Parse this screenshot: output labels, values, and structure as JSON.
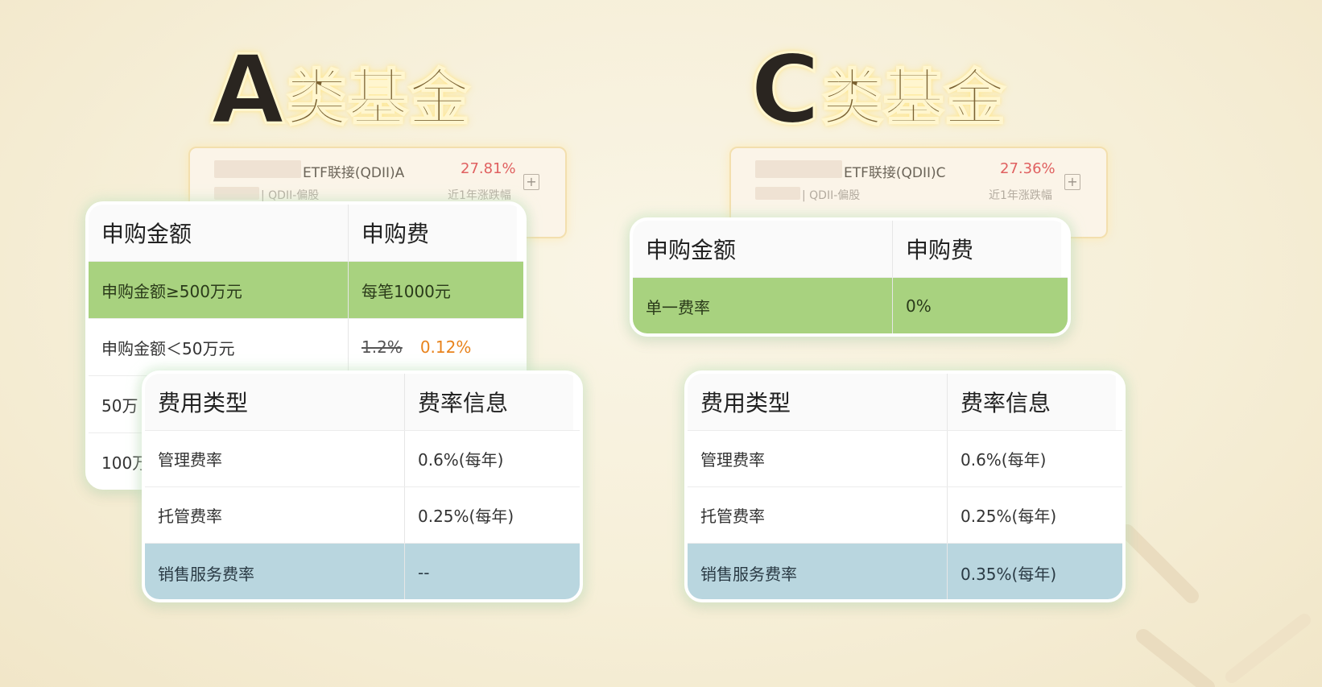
{
  "fundA": {
    "title_letter": "A",
    "title_rest": "类基金",
    "card": {
      "name": "ETF联接(QDII)A",
      "return_pct": "27.81%",
      "category": "| QDII-偏股",
      "return_label": "近1年涨跌幅",
      "add": "+"
    },
    "subscription": {
      "headers": [
        "申购金额",
        "申购费"
      ],
      "rows": [
        {
          "amount": "申购金额≥500万元",
          "fee": "每笔1000元"
        },
        {
          "amount": "申购金额＜50万元",
          "fee_original": "1.2%",
          "fee_discount": "0.12%"
        },
        {
          "amount": "50万"
        },
        {
          "amount": "100万"
        }
      ]
    },
    "fees": {
      "headers": [
        "费用类型",
        "费率信息"
      ],
      "rows": [
        {
          "type": "管理费率",
          "rate": "0.6%(每年)"
        },
        {
          "type": "托管费率",
          "rate": "0.25%(每年)"
        },
        {
          "type": "销售服务费率",
          "rate": "--"
        }
      ]
    }
  },
  "fundC": {
    "title_letter": "C",
    "title_rest": "类基金",
    "card": {
      "name": "ETF联接(QDII)C",
      "return_pct": "27.36%",
      "category": "| QDII-偏股",
      "return_label": "近1年涨跌幅",
      "add": "+"
    },
    "subscription": {
      "headers": [
        "申购金额",
        "申购费"
      ],
      "rows": [
        {
          "amount": "单一费率",
          "fee": "0%"
        }
      ]
    },
    "fees": {
      "headers": [
        "费用类型",
        "费率信息"
      ],
      "rows": [
        {
          "type": "管理费率",
          "rate": "0.6%(每年)"
        },
        {
          "type": "托管费率",
          "rate": "0.25%(每年)"
        },
        {
          "type": "销售服务费率",
          "rate": "0.35%(每年)"
        }
      ]
    }
  },
  "colors": {
    "green_row": "#a8d27f",
    "blue_row": "#b9d6df",
    "discount": "#e8831c",
    "return": "#e06060"
  }
}
